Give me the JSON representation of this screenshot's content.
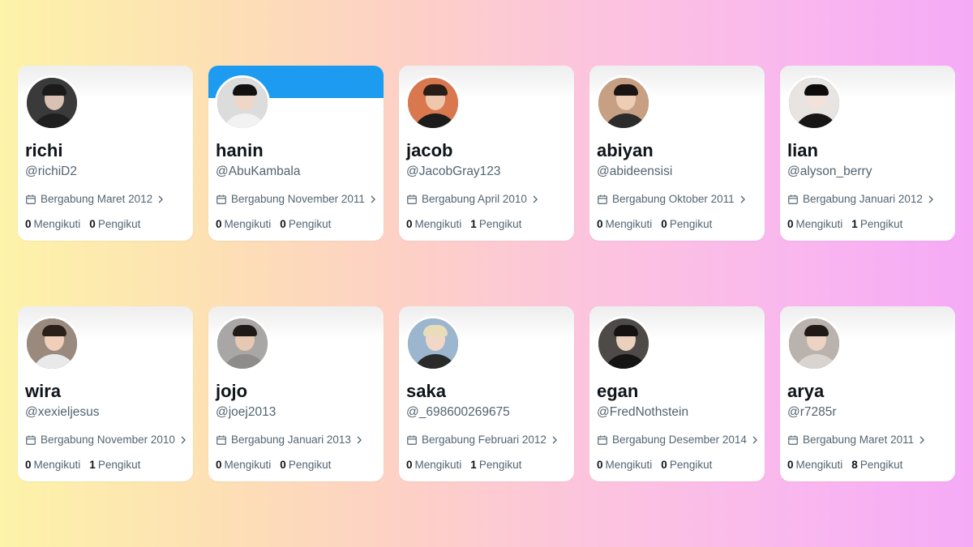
{
  "labels": {
    "following": "Mengikuti",
    "followers": "Pengikut"
  },
  "icons": {
    "calendar": "calendar-icon",
    "chevron": "chevron-right-icon"
  },
  "colors": {
    "text_primary": "#0f1419",
    "text_secondary": "#536471",
    "accent_banner": "#1d9bf0"
  },
  "profiles": [
    {
      "name": "richi",
      "handle": "@richiD2",
      "joined": "Bergabung Maret 2012",
      "following": "0",
      "followers": "0",
      "banner": "plain"
    },
    {
      "name": "hanin",
      "handle": "@AbuKambala",
      "joined": "Bergabung November 2011",
      "following": "0",
      "followers": "0",
      "banner": "blue"
    },
    {
      "name": "jacob",
      "handle": "@JacobGray123",
      "joined": "Bergabung April 2010",
      "following": "0",
      "followers": "1",
      "banner": "plain"
    },
    {
      "name": "abiyan",
      "handle": "@abideensisi",
      "joined": "Bergabung Oktober 2011",
      "following": "0",
      "followers": "0",
      "banner": "plain"
    },
    {
      "name": "lian",
      "handle": "@alyson_berry",
      "joined": "Bergabung Januari 2012",
      "following": "0",
      "followers": "1",
      "banner": "plain"
    },
    {
      "name": "wira",
      "handle": "@xexieljesus",
      "joined": "Bergabung November 2010",
      "following": "0",
      "followers": "1",
      "banner": "plain"
    },
    {
      "name": "jojo",
      "handle": "@joej2013",
      "joined": "Bergabung Januari 2013",
      "following": "0",
      "followers": "0",
      "banner": "plain"
    },
    {
      "name": "saka",
      "handle": "@_698600269675",
      "joined": "Bergabung Februari 2012",
      "following": "0",
      "followers": "1",
      "banner": "plain"
    },
    {
      "name": "egan",
      "handle": "@FredNothstein",
      "joined": "Bergabung Desember 2014",
      "following": "0",
      "followers": "0",
      "banner": "plain"
    },
    {
      "name": "arya",
      "handle": "@r7285r",
      "joined": "Bergabung Maret 2011",
      "following": "0",
      "followers": "8",
      "banner": "plain"
    }
  ]
}
